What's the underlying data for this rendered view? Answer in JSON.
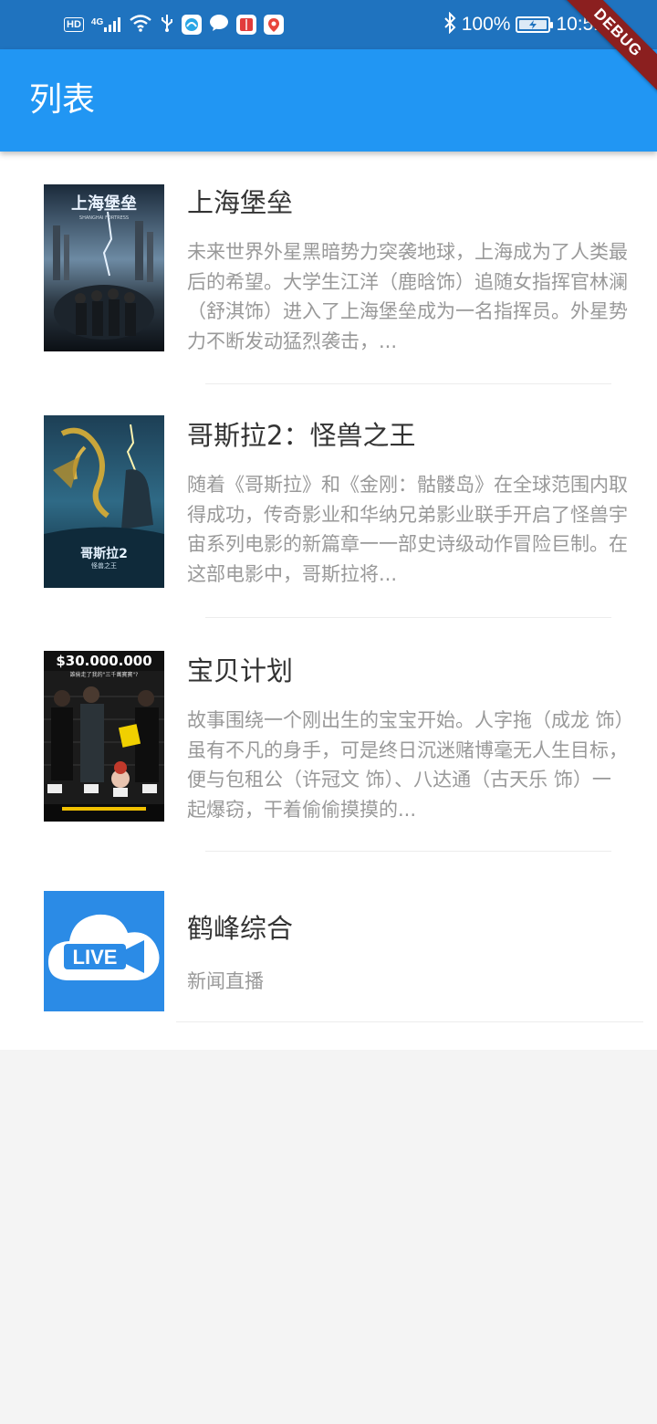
{
  "status_bar": {
    "hd": "HD",
    "network": "4G",
    "battery": "100%",
    "time": "10:51"
  },
  "debug_banner": "DEBUG",
  "app_bar": {
    "title": "列表"
  },
  "items": [
    {
      "title": "上海堡垒",
      "description": "未来世界外星黑暗势力突袭地球，上海成为了人类最后的希望。大学生江洋（鹿晗饰）追随女指挥官林澜（舒淇饰）进入了上海堡垒成为一名指挥员。外星势力不断发动猛烈袭击，...",
      "poster_text": "上海堡垒",
      "poster_subtext": "SHANGHAI FORTRESS"
    },
    {
      "title": "哥斯拉2：怪兽之王",
      "description": "随着《哥斯拉》和《金刚：骷髅岛》在全球范围内取得成功，传奇影业和华纳兄弟影业联手开启了怪兽宇宙系列电影的新篇章一一部史诗级动作冒险巨制。在这部电影中，哥斯拉将...",
      "poster_text": "哥斯拉2",
      "poster_subtext": "怪兽之王"
    },
    {
      "title": "宝贝计划",
      "description": "故事围绕一个刚出生的宝宝开始。人字拖（成龙 饰）虽有不凡的身手，可是终日沉迷赌博毫无人生目标，便与包租公（许冠文 饰）、八达通（古天乐 饰）一起爆窃，干着偷偷摸摸的...",
      "poster_text": "$30.000.000",
      "poster_subtext": "誰偷走了我的\"三千萬寶寶\"?"
    },
    {
      "title": "鹤峰综合",
      "description": "新闻直播",
      "poster_text": "LIVE"
    }
  ],
  "colors": {
    "status_bar": "#1f73bf",
    "app_bar": "#2196f3",
    "debug": "#8b1f1f",
    "live_bg": "#2b8be6"
  }
}
